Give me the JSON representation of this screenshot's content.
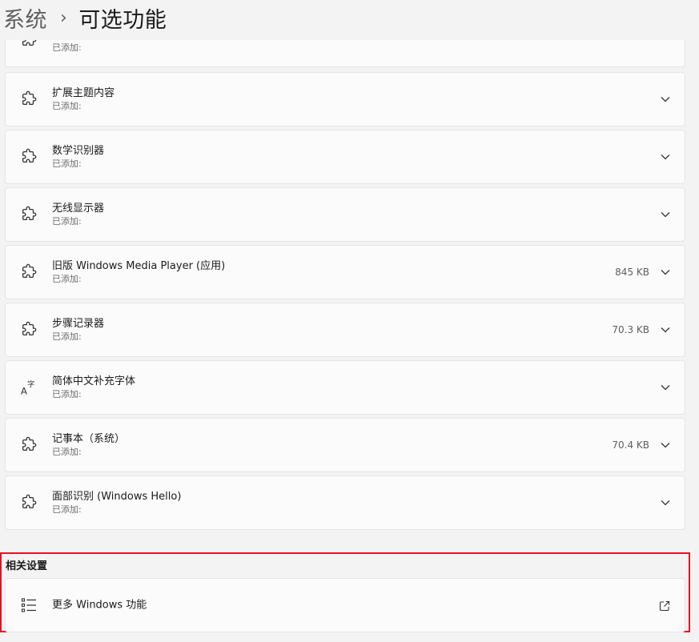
{
  "breadcrumb": {
    "parent": "系统",
    "separator": "›",
    "current": "可选功能"
  },
  "top_partial_item": {
    "subtitle": "已添加:",
    "icon": "puzzle-piece-icon"
  },
  "features": [
    {
      "title": "扩展主题内容",
      "subtitle": "已添加:",
      "size": "",
      "icon": "puzzle-piece-icon"
    },
    {
      "title": "数学识别器",
      "subtitle": "已添加:",
      "size": "",
      "icon": "puzzle-piece-icon"
    },
    {
      "title": "无线显示器",
      "subtitle": "已添加:",
      "size": "",
      "icon": "puzzle-piece-icon"
    },
    {
      "title": "旧版 Windows Media Player (应用)",
      "subtitle": "已添加:",
      "size": "845 KB",
      "icon": "puzzle-piece-icon"
    },
    {
      "title": "步骤记录器",
      "subtitle": "已添加:",
      "size": "70.3 KB",
      "icon": "puzzle-piece-icon"
    },
    {
      "title": "简体中文补充字体",
      "subtitle": "已添加:",
      "size": "",
      "icon": "font-icon"
    },
    {
      "title": "记事本（系统）",
      "subtitle": "已添加:",
      "size": "70.4 KB",
      "icon": "puzzle-piece-icon"
    },
    {
      "title": "面部识别 (Windows Hello)",
      "subtitle": "已添加:",
      "size": "",
      "icon": "puzzle-piece-icon"
    }
  ],
  "related_settings": {
    "header": "相关设置",
    "more_features_label": "更多 Windows 功能",
    "more_features_icon": "list-icon",
    "external_icon": "open-external-icon"
  },
  "colors": {
    "highlight_border": "#e81123",
    "card_background": "#fbfbfb",
    "page_background": "#f3f3f3"
  }
}
